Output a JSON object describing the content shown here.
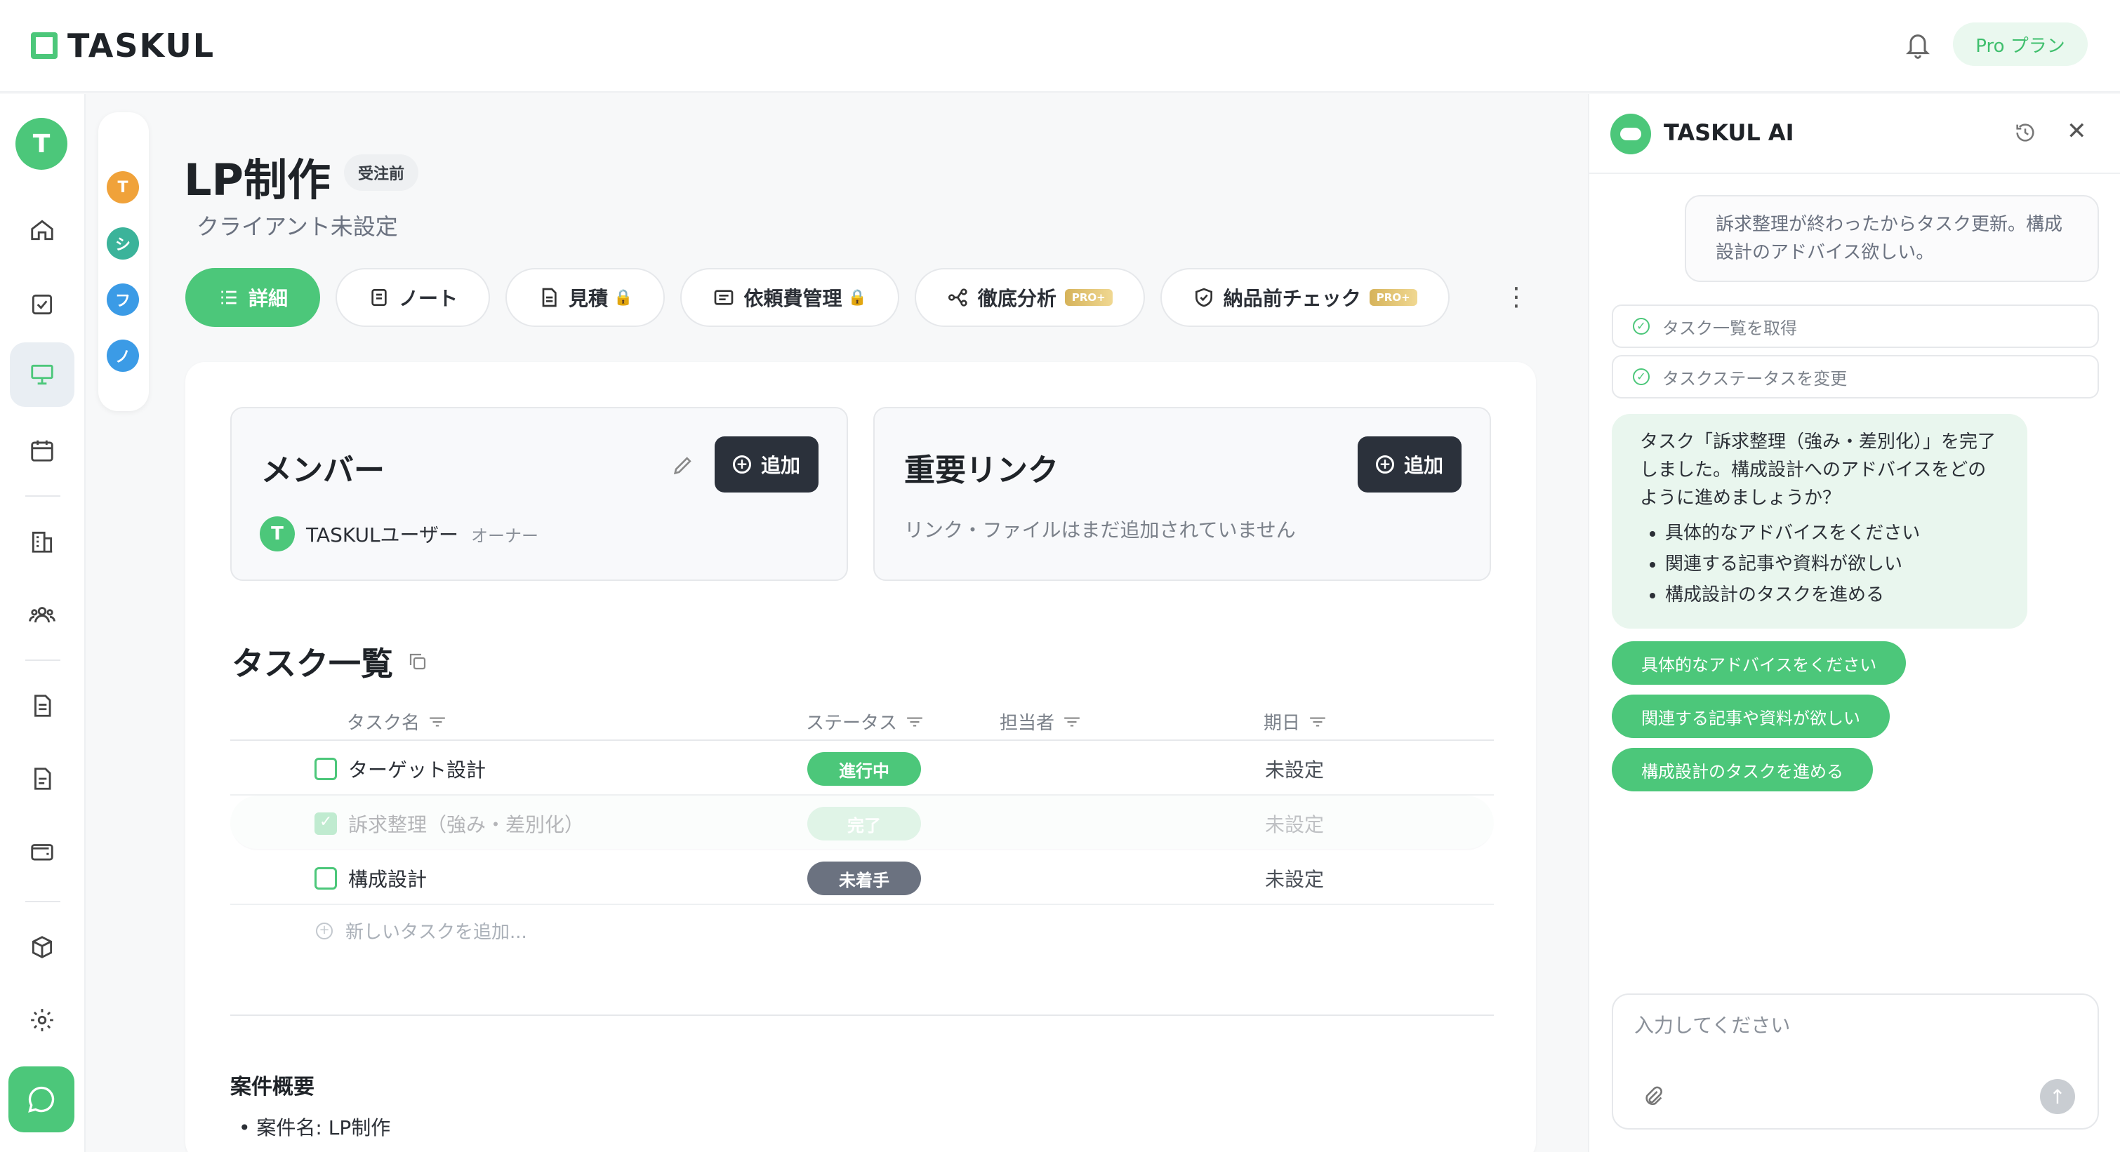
{
  "app": {
    "name": "TASKUL",
    "plan_label": "Pro プラン"
  },
  "user": {
    "initial": "T"
  },
  "mini_members": [
    {
      "initial": "T",
      "color": "#f0a23a"
    },
    {
      "initial": "シ",
      "color": "#3bb39a"
    },
    {
      "initial": "フ",
      "color": "#3b9be6"
    },
    {
      "initial": "ノ",
      "color": "#3b9be6"
    }
  ],
  "project": {
    "title": "LP制作",
    "status_badge": "受注前",
    "client": "クライアント未設定"
  },
  "tabs": [
    {
      "label": "詳細",
      "icon": "list-icon",
      "active": true
    },
    {
      "label": "ノート",
      "icon": "note-icon"
    },
    {
      "label": "見積",
      "icon": "document-icon",
      "locked": true
    },
    {
      "label": "依頼費管理",
      "icon": "invoice-icon",
      "locked": true
    },
    {
      "label": "徹底分析",
      "icon": "analysis-icon",
      "badge": "PRO+"
    },
    {
      "label": "納品前チェック",
      "icon": "shield-check-icon",
      "badge": "PRO+"
    }
  ],
  "members": {
    "title": "メンバー",
    "add_label": "追加",
    "items": [
      {
        "initial": "T",
        "name": "TASKULユーザー",
        "role": "オーナー"
      }
    ]
  },
  "links": {
    "title": "重要リンク",
    "add_label": "追加",
    "empty": "リンク・ファイルはまだ追加されていません"
  },
  "tasks": {
    "title": "タスク一覧",
    "columns": {
      "name": "タスク名",
      "status": "ステータス",
      "assignee": "担当者",
      "due": "期日"
    },
    "rows": [
      {
        "name": "ターゲット設計",
        "status": "進行中",
        "status_color": "#4cc77a",
        "due": "未設定",
        "done": false
      },
      {
        "name": "訴求整理（強み・差別化）",
        "status": "完了",
        "status_color": "#a8e0bd",
        "due": "未設定",
        "done": true
      },
      {
        "name": "構成設計",
        "status": "未着手",
        "status_color": "#6b7280",
        "due": "未設定",
        "done": false
      }
    ],
    "add_placeholder": "新しいタスクを追加..."
  },
  "overview": {
    "title": "案件概要",
    "items": [
      "案件名: LP制作"
    ]
  },
  "ai": {
    "title": "TASKUL AI",
    "user_message": "訴求整理が終わったからタスク更新。構成設計のアドバイス欲しい。",
    "tool_calls": [
      "タスク一覧を取得",
      "タスクステータスを変更"
    ],
    "reply": "タスク「訴求整理（強み・差別化）」を完了しました。構成設計へのアドバイスをどのように進めましょうか？",
    "reply_options": [
      "具体的なアドバイスをください",
      "関連する記事や資料が欲しい",
      "構成設計のタスクを進める"
    ],
    "suggestions": [
      "具体的なアドバイスをください",
      "関連する記事や資料が欲しい",
      "構成設計のタスクを進める"
    ],
    "input_placeholder": "入力してください"
  },
  "colors": {
    "accent": "#4cc77a",
    "dark_button": "#2b313b",
    "pro_gold": "#d6b35a"
  }
}
